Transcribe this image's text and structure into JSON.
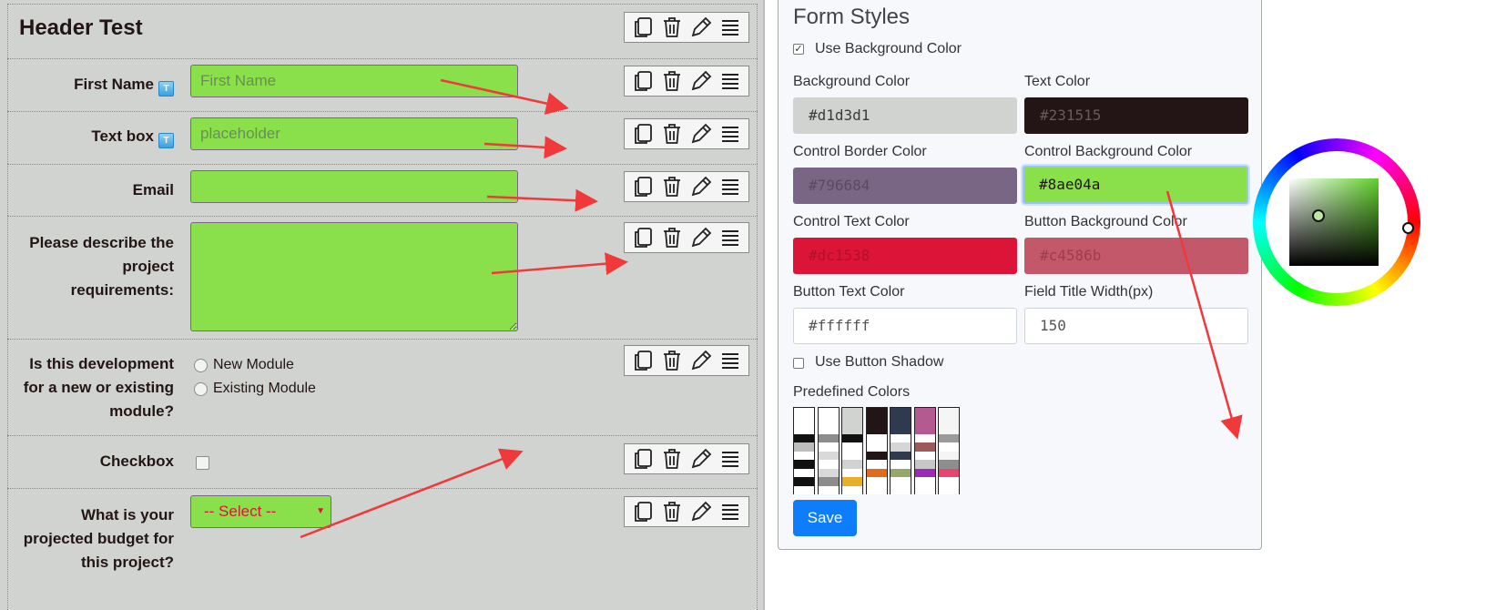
{
  "form": {
    "header_title": "Header Test",
    "fields": [
      {
        "label": "First Name",
        "placeholder": "First Name",
        "has_info_icon": true
      },
      {
        "label": "Text box",
        "placeholder": "placeholder",
        "has_info_icon": true
      },
      {
        "label": "Email",
        "placeholder": ""
      },
      {
        "label_lines": [
          "Please describe the",
          "project",
          "requirements:"
        ]
      },
      {
        "label_lines": [
          "Is this development",
          "for a new or existing",
          "module?"
        ],
        "options": [
          "New Module",
          "Existing Module"
        ]
      },
      {
        "label": "Checkbox"
      },
      {
        "label_lines": [
          "What is your",
          "projected budget for",
          "this project?"
        ],
        "select_value": "-- Select --"
      }
    ],
    "info_icon_glyph": "T",
    "tool_icons": [
      "copy-icon",
      "trash-icon",
      "pencil-icon",
      "menu-icon"
    ]
  },
  "panel": {
    "title": "Form Styles",
    "use_bg_label": "Use Background Color",
    "use_bg_checked": true,
    "bg_color_label": "Background Color",
    "bg_color_value": "#d1d3d1",
    "text_color_label": "Text Color",
    "text_color_value": "#231515",
    "ctrl_border_label": "Control Border Color",
    "ctrl_border_value": "#796684",
    "ctrl_bg_label": "Control Background Color",
    "ctrl_bg_value": "#8ae04a",
    "ctrl_text_label": "Control Text Color",
    "ctrl_text_value": "#dc1538",
    "btn_bg_label": "Button Background Color",
    "btn_bg_value": "#c4586b",
    "btn_text_label": "Button Text Color",
    "btn_text_value": "#ffffff",
    "title_width_label": "Field Title Width(px)",
    "title_width_value": "150",
    "use_shadow_label": "Use Button Shadow",
    "use_shadow_checked": false,
    "predefined_label": "Predefined Colors",
    "save_label": "Save"
  },
  "colors": {
    "accent_blue": "#0d7dfb",
    "arrow_red": "#f0393a"
  },
  "swatches": [
    [
      "#ffffff",
      "#ffffff",
      "#ffffff",
      "#111111",
      "#bdbdbd",
      "#ffffff",
      "#111111",
      "#ffffff",
      "#111111",
      "#ffffff"
    ],
    [
      "#ffffff",
      "#ffffff",
      "#ffffff",
      "#8c8c8c",
      "#ffffff",
      "#d9d9d9",
      "#ffffff",
      "#d9d9d9",
      "#8c8c8c",
      "#ffffff"
    ],
    [
      "#d1d3d1",
      "#d1d3d1",
      "#d1d3d1",
      "#111111",
      "#ffffff",
      "#ffffff",
      "#d1d3d1",
      "#ffffff",
      "#e8b028",
      "#ffffff"
    ],
    [
      "#231515",
      "#231515",
      "#231515",
      "#ffffff",
      "#ffffff",
      "#231515",
      "#ffffff",
      "#e06b1c",
      "#ffffff",
      "#ffffff"
    ],
    [
      "#303a4f",
      "#303a4f",
      "#303a4f",
      "#ffffff",
      "#d6d6d6",
      "#303a4f",
      "#ffffff",
      "#94a86a",
      "#ffffff",
      "#ffffff"
    ],
    [
      "#b35b91",
      "#b35b91",
      "#b35b91",
      "#ffffff",
      "#9c5a5a",
      "#ffffff",
      "#c7c7c7",
      "#9b2ab8",
      "#ffffff",
      "#ffffff"
    ],
    [
      "#f5f5f5",
      "#f5f5f5",
      "#f5f5f5",
      "#9a9a9a",
      "#ffffff",
      "#f5f5f5",
      "#8e8e8e",
      "#e8456e",
      "#ffffff",
      "#ffffff"
    ]
  ]
}
